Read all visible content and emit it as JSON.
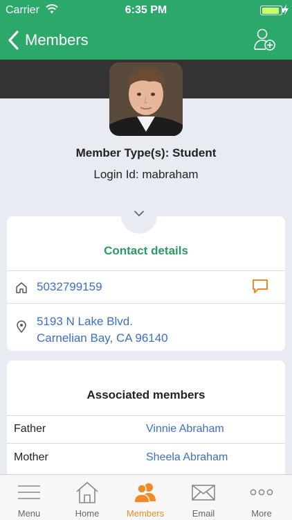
{
  "status_bar": {
    "carrier": "Carrier",
    "time": "6:35 PM"
  },
  "nav": {
    "back_label": "Members"
  },
  "profile": {
    "member_type": "Member Type(s): Student",
    "login_id": "Login Id: mabraham"
  },
  "contact": {
    "title": "Contact details",
    "phone": "5032799159",
    "address_line1": "5193 N Lake Blvd.",
    "address_line2": "Carnelian Bay, CA 96140"
  },
  "associated": {
    "title": "Associated members",
    "rows": [
      {
        "relation": "Father",
        "name": "Vinnie Abraham"
      },
      {
        "relation": "Mother",
        "name": "Sheela Abraham"
      }
    ]
  },
  "tabbar": {
    "tabs": [
      {
        "label": "Menu",
        "icon": "menu-icon"
      },
      {
        "label": "Home",
        "icon": "home-icon"
      },
      {
        "label": "Members",
        "icon": "members-icon"
      },
      {
        "label": "Email",
        "icon": "email-icon"
      },
      {
        "label": "More",
        "icon": "more-icon"
      }
    ],
    "active": "Members"
  },
  "colors": {
    "brand_green": "#2ba86a",
    "link_blue": "#3c6fc4",
    "accent_orange": "#f08a24"
  }
}
